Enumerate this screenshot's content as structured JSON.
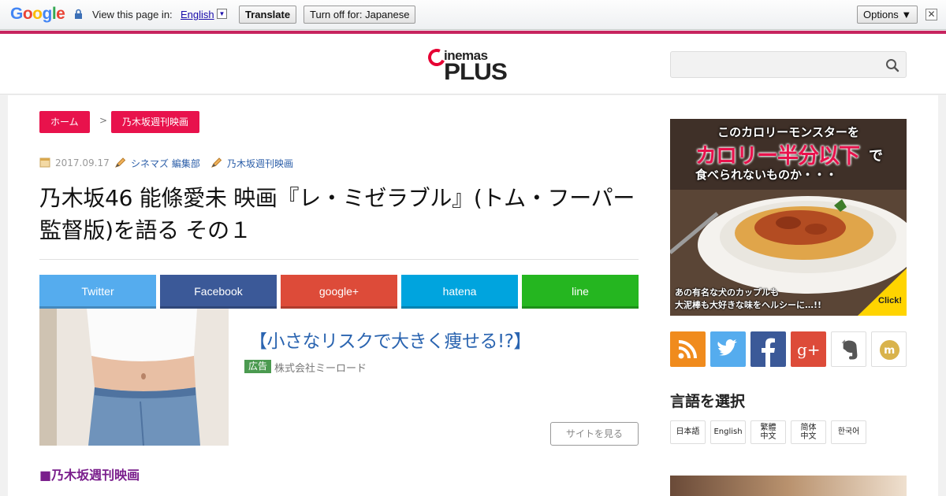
{
  "translate_bar": {
    "logo": "Google",
    "view_text": "View this page in:",
    "language": "English",
    "translate_label": "Translate",
    "turn_off_label": "Turn off for: Japanese",
    "options_label": "Options ▼",
    "close_symbol": "✕"
  },
  "site": {
    "logo_top": "inemas",
    "logo_bottom": "PLUS",
    "search_placeholder": ""
  },
  "breadcrumb": {
    "home": "ホーム",
    "separator": ">",
    "category": "乃木坂週刊映画"
  },
  "meta": {
    "date": "2017.09.17",
    "author": "シネマズ 編集部",
    "tag": "乃木坂週刊映画"
  },
  "article": {
    "title": "乃木坂46 能條愛未 映画『レ・ミゼラブル』(トム・フーパー監督版)を語る その１",
    "section_heading": "■乃木坂週刊映画"
  },
  "share": {
    "twitter": "Twitter",
    "facebook": "Facebook",
    "googleplus": "google+",
    "hatena": "hatena",
    "line": "line"
  },
  "ad": {
    "title": "【小さなリスクで大きく痩せる!?】",
    "badge": "広告",
    "sponsor": "株式会社ミーロード",
    "button": "サイトを見る"
  },
  "sidebar": {
    "banner": {
      "line1": "このカロリーモンスターを",
      "line2": "カロリー半分以下",
      "line2b": "で",
      "line3": "食べられないものか・・・",
      "line4": "あの有名な犬のカップルも",
      "line5": "大泥棒も大好きな味をヘルシーに…!!",
      "click": "Click!"
    },
    "language_heading": "言語を選択",
    "languages": {
      "ja": "日本語",
      "en": "English",
      "zt_1": "繁體",
      "zt_2": "中文",
      "zs_1": "简体",
      "zs_2": "中文",
      "ko": "한국어"
    }
  },
  "colors": {
    "accent": "#e8124c",
    "link": "#2a5da8",
    "twitter": "#55acee",
    "facebook": "#3b5998",
    "googleplus": "#dd4b39",
    "hatena": "#00a4de",
    "line": "#25b620",
    "rss": "#f08b1d",
    "section": "#7a1e8c"
  }
}
